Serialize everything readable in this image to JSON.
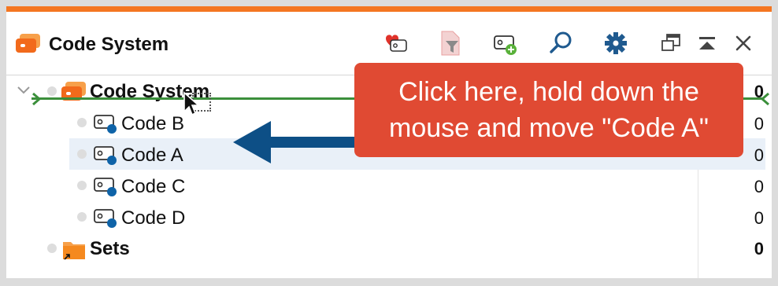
{
  "window": {
    "title": "Code System",
    "accent_color": "#f47621"
  },
  "toolbar": {
    "buttons": [
      {
        "name": "activate-codes-icon"
      },
      {
        "name": "filter-icon"
      },
      {
        "name": "new-code-icon"
      },
      {
        "name": "search-icon"
      },
      {
        "name": "settings-icon"
      },
      {
        "name": "undock-icon"
      },
      {
        "name": "collapse-icon"
      },
      {
        "name": "close-icon"
      }
    ]
  },
  "tree": {
    "root": {
      "label": "Code System",
      "count": "0"
    },
    "codes": [
      {
        "label": "Code B",
        "count": "0"
      },
      {
        "label": "Code A",
        "count": "0"
      },
      {
        "label": "Code C",
        "count": "0"
      },
      {
        "label": "Code D",
        "count": "0"
      }
    ],
    "sets": {
      "label": "Sets",
      "count": "0"
    }
  },
  "callout": {
    "line1": "Click here, hold down the",
    "line2": "mouse and move \"Code A\"",
    "color": "#e04a33"
  },
  "arrow_color": "#0d4f86",
  "dropline_color": "#3b8f3b"
}
